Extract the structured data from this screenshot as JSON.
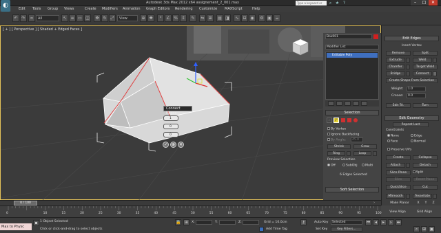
{
  "title": "Autodesk 3ds Max  2012 x64      assignement_2_001.max",
  "search": {
    "placeholder": "Type a keyword or phrase"
  },
  "menu": [
    "Edit",
    "Tools",
    "Group",
    "Views",
    "Create",
    "Modifiers",
    "Animation",
    "Graph Editors",
    "Rendering",
    "Customize",
    "MAXScript",
    "Help"
  ],
  "toolbar": {
    "selection_filter": "All",
    "ref_coord": "View"
  },
  "viewport": {
    "label": "[ + ] [ Perspective ] [ Shaded + Edged Faces ]",
    "caddy": {
      "title": "Connect Edges",
      "segments": "1",
      "pinch": "0",
      "slide": "0"
    }
  },
  "modifier_panel": {
    "object_name": "Box001",
    "modifier_list": "Modifier List",
    "stack_item": "Editable Poly",
    "selection": {
      "header": "Selection",
      "by_vertex": "By Vertex",
      "ignore_backfacing": "Ignore Backfacing",
      "by_angle": "By Angle:",
      "angle_value": "45.0",
      "shrink": "Shrink",
      "grow": "Grow",
      "ring": "Ring",
      "loop": "Loop",
      "preview_selection": "Preview Selection",
      "preview_options": [
        "Off",
        "SubObj",
        "Multi"
      ],
      "status": "6 Edges Selected"
    },
    "soft_selection": "Soft Selection"
  },
  "command_panel": {
    "edit_edges": {
      "header": "Edit Edges",
      "insert_vertex": "Insert Vertex",
      "remove": "Remove",
      "split": "Split",
      "extrude": "Extrude",
      "weld": "Weld",
      "chamfer": "Chamfer",
      "target_weld": "Target Weld",
      "bridge": "Bridge",
      "connect": "Connect",
      "create_shape": "Create Shape From Selection",
      "weight_label": "Weight:",
      "weight_value": "1.0",
      "crease_label": "Crease:",
      "crease_value": "0.0",
      "edit_tri": "Edit Tri.",
      "turn": "Turn"
    },
    "edit_geometry": {
      "header": "Edit Geometry",
      "repeat_last": "Repeat Last",
      "constraints": "Constraints",
      "none": "None",
      "edge": "Edge",
      "face": "Face",
      "normal": "Normal",
      "preserve_uvs": "Preserve UVs",
      "create": "Create",
      "collapse": "Collapse",
      "attach": "Attach",
      "detach": "Detach",
      "slice_plane": "Slice Plane",
      "split": "Split",
      "slice": "Slice",
      "reset_plane": "Reset Plane",
      "quickslice": "QuickSlice",
      "cut": "Cut",
      "msmooth": "MSmooth",
      "tessellate": "Tessellate",
      "make_planar": "Make Planar",
      "x": "X",
      "y": "Y",
      "z": "Z",
      "view_align": "View Align",
      "grid_align": "Grid Align"
    }
  },
  "timeline": {
    "frame": "0 / 100"
  },
  "ruler_ticks": [
    "0",
    "10",
    "15",
    "20",
    "25",
    "30",
    "35",
    "40",
    "45",
    "50",
    "55",
    "60",
    "65",
    "70",
    "75",
    "80",
    "85",
    "90",
    "95",
    "100"
  ],
  "status": {
    "maxscript": "Max to Physc",
    "selected": "1 Object Selected",
    "prompt": "Click or click-and-drag to select objects",
    "x_label": "X:",
    "y_label": "Y:",
    "z_label": "Z:",
    "grid": "Grid = 10.0cm",
    "add_time_tag": "Add Time Tag",
    "auto_key": "Auto Key",
    "auto_key_sel": "Selected",
    "set_key": "Set Key",
    "key_filters": "Key Filters..."
  }
}
